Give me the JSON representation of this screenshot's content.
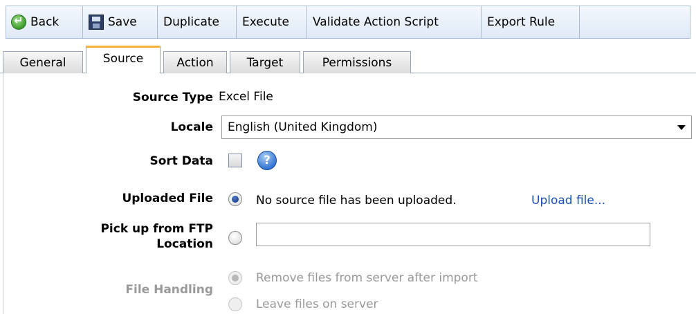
{
  "toolbar": {
    "back": "Back",
    "save": "Save",
    "duplicate": "Duplicate",
    "execute": "Execute",
    "validate": "Validate Action Script",
    "export": "Export Rule"
  },
  "tabs": [
    "General",
    "Source",
    "Action",
    "Target",
    "Permissions"
  ],
  "active_tab": "Source",
  "form": {
    "source_type_label": "Source Type",
    "source_type_value": "Excel File",
    "locale_label": "Locale",
    "locale_value": "English (United Kingdom)",
    "sort_data_label": "Sort Data",
    "uploaded_file_label": "Uploaded File",
    "no_file_msg": "No source file has been uploaded.",
    "upload_link": "Upload file...",
    "ftp_label_line1": "Pick up from FTP",
    "ftp_label_line2": "Location",
    "ftp_value": "",
    "file_handling_label": "File Handling",
    "remove_files_option": "Remove files from server after import",
    "leave_files_option": "Leave files on server"
  }
}
